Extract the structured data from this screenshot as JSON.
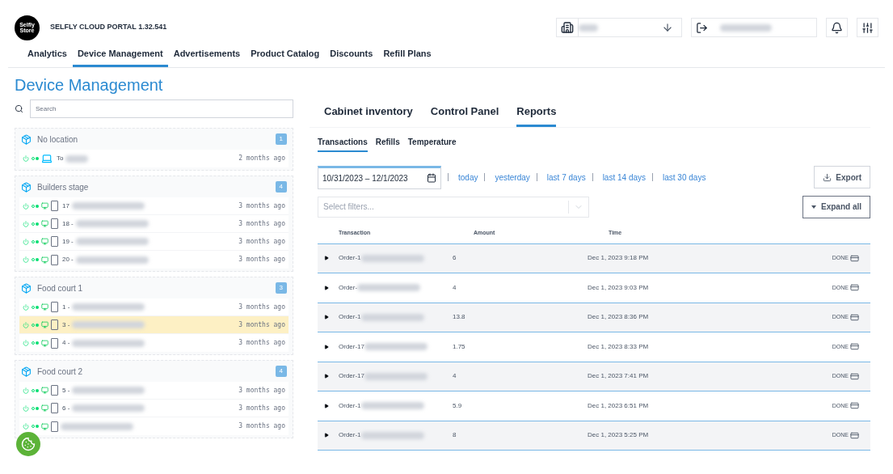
{
  "header": {
    "logo": "Selfly Store",
    "portal_title": "SELFLY CLOUD PORTAL 1.32.541"
  },
  "nav_tabs": [
    {
      "label": "Analytics",
      "selected": false
    },
    {
      "label": "Device Management",
      "selected": true
    },
    {
      "label": "Advertisements",
      "selected": false
    },
    {
      "label": "Product Catalog",
      "selected": false
    },
    {
      "label": "Discounts",
      "selected": false
    },
    {
      "label": "Refill Plans",
      "selected": false
    }
  ],
  "page_title": "Device Management",
  "search": {
    "placeholder": "Search"
  },
  "locations": [
    {
      "name": "No location",
      "count": "1",
      "devices": [
        {
          "kind": "laptop",
          "name": "To",
          "time": "2 months ago",
          "selected": false
        }
      ]
    },
    {
      "name": "Builders stage",
      "count": "4",
      "devices": [
        {
          "kind": "cabinet",
          "name": "17",
          "time": "3 months ago",
          "selected": false
        },
        {
          "kind": "cabinet",
          "name": "18 -",
          "time": "3 months ago",
          "selected": false
        },
        {
          "kind": "cabinet",
          "name": "19 -",
          "time": "3 months ago",
          "selected": false
        },
        {
          "kind": "cabinet",
          "name": "20 -",
          "time": "3 months ago",
          "selected": false
        }
      ]
    },
    {
      "name": "Food court 1",
      "count": "3",
      "devices": [
        {
          "kind": "cabinet",
          "name": "1 -",
          "time": "3 months ago",
          "selected": false
        },
        {
          "kind": "cabinet",
          "name": "3 -",
          "time": "3 months ago",
          "selected": true
        },
        {
          "kind": "cabinet",
          "name": "4 -",
          "time": "3 months ago",
          "selected": false
        }
      ]
    },
    {
      "name": "Food court 2",
      "count": "4",
      "devices": [
        {
          "kind": "cabinet",
          "name": "5 -",
          "time": "3 months ago",
          "selected": false
        },
        {
          "kind": "cabinet",
          "name": "6 -",
          "time": "3 months ago",
          "selected": false
        },
        {
          "kind": "cabinet",
          "time": "3 months ago",
          "selected": false
        }
      ]
    }
  ],
  "device_tabs": [
    {
      "label": "Cabinet inventory",
      "selected": false
    },
    {
      "label": "Control Panel",
      "selected": false
    },
    {
      "label": "Reports",
      "selected": true
    }
  ],
  "report_tabs": [
    {
      "label": "Transactions",
      "selected": true
    },
    {
      "label": "Refills",
      "selected": false
    },
    {
      "label": "Temperature",
      "selected": false
    }
  ],
  "date_range": {
    "value": "10/31/2023 – 12/1/2023"
  },
  "quick_ranges": [
    "today",
    "yesterday",
    "last 7 days",
    "last 14 days",
    "last 30 days"
  ],
  "export_button": "Export",
  "filters": {
    "placeholder": "Select filters..."
  },
  "expand_button": "Expand all",
  "table": {
    "columns": [
      "Transaction",
      "Amount",
      "Time"
    ],
    "rows": [
      {
        "transaction": "Order-1",
        "amount": "6",
        "time": "Dec 1, 2023 9:18 PM",
        "status": "DONE"
      },
      {
        "transaction": "Order-",
        "amount": "4",
        "time": "Dec 1, 2023 9:03 PM",
        "status": "DONE"
      },
      {
        "transaction": "Order-1",
        "amount": "13.8",
        "time": "Dec 1, 2023 8:36 PM",
        "status": "DONE"
      },
      {
        "transaction": "Order-17",
        "amount": "1.75",
        "time": "Dec 1, 2023 8:33 PM",
        "status": "DONE"
      },
      {
        "transaction": "Order-17",
        "amount": "4",
        "time": "Dec 1, 2023 7:41 PM",
        "status": "DONE"
      },
      {
        "transaction": "Order-1",
        "amount": "5.9",
        "time": "Dec 1, 2023 6:51 PM",
        "status": "DONE"
      },
      {
        "transaction": "Order-1",
        "amount": "8",
        "time": "Dec 1, 2023 5:25 PM",
        "status": "DONE"
      }
    ]
  }
}
